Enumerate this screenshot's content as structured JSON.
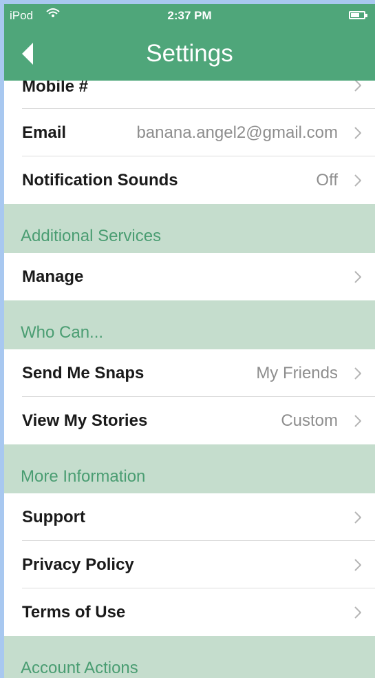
{
  "status_bar": {
    "carrier": "iPod",
    "time": "2:37 PM"
  },
  "nav": {
    "title": "Settings"
  },
  "rows_top": [
    {
      "label": "Mobile #",
      "value": ""
    },
    {
      "label": "Email",
      "value": "banana.angel2@gmail.com"
    },
    {
      "label": "Notification Sounds",
      "value": "Off"
    }
  ],
  "sections": [
    {
      "title": "Additional Services",
      "rows": [
        {
          "label": "Manage",
          "value": ""
        }
      ]
    },
    {
      "title": "Who Can...",
      "rows": [
        {
          "label": "Send Me Snaps",
          "value": "My Friends"
        },
        {
          "label": "View My Stories",
          "value": "Custom"
        }
      ]
    },
    {
      "title": "More Information",
      "rows": [
        {
          "label": "Support",
          "value": ""
        },
        {
          "label": "Privacy Policy",
          "value": ""
        },
        {
          "label": "Terms of Use",
          "value": ""
        }
      ]
    },
    {
      "title": "Account Actions",
      "rows": []
    }
  ],
  "colors": {
    "accent": "#4fa67a",
    "section_bg": "#c5ddcd",
    "section_text": "#4a9d72",
    "value_text": "#8e8e8e"
  }
}
